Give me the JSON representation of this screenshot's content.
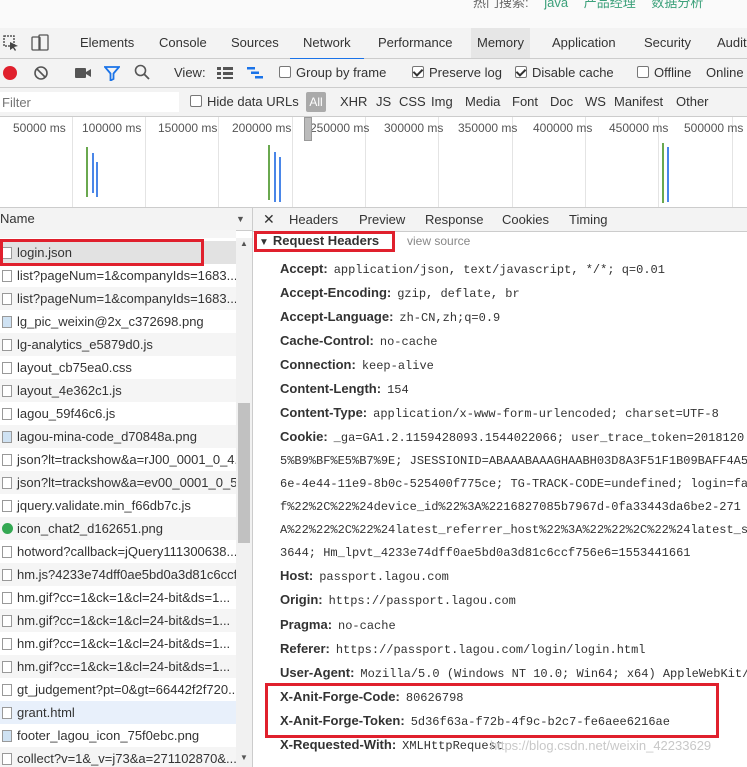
{
  "top": {
    "hot_label": "热门搜索:",
    "keywords": [
      "java",
      "产品经理",
      "数据分析"
    ]
  },
  "devtools_tabs": [
    "Elements",
    "Console",
    "Sources",
    "Network",
    "Performance",
    "Memory",
    "Application",
    "Security",
    "Audit"
  ],
  "active_tab": "Network",
  "toolbar": {
    "view_label": "View:",
    "group_by_frame": "Group by frame",
    "preserve_log": "Preserve log",
    "disable_cache": "Disable cache",
    "offline": "Offline",
    "online": "Online"
  },
  "filterbar": {
    "placeholder": "Filter",
    "hide_data_urls": "Hide data URLs",
    "all": "All",
    "types": [
      "XHR",
      "JS",
      "CSS",
      "Img",
      "Media",
      "Font",
      "Doc",
      "WS",
      "Manifest",
      "Other"
    ]
  },
  "timeline": [
    "50000 ms",
    "100000 ms",
    "150000 ms",
    "200000 ms",
    "250000 ms",
    "300000 ms",
    "350000 ms",
    "400000 ms",
    "450000 ms",
    "500000 ms"
  ],
  "requests": {
    "column_header": "Name",
    "items": [
      "login.json",
      "list?pageNum=1&companyIds=1683...",
      "list?pageNum=1&companyIds=1683...",
      "lg_pic_weixin@2x_c372698.png",
      "lg-analytics_e5879d0.js",
      "layout_cb75ea0.css",
      "layout_4e362c1.js",
      "lagou_59f46c6.js",
      "lagou-mina-code_d70848a.png",
      "json?lt=trackshow&a=rJ00_0001_0_4...",
      "json?lt=trackshow&a=ev00_0001_0_5...",
      "jquery.validate.min_f66db7c.js",
      "icon_chat2_d162651.png",
      "hotword?callback=jQuery111300638...",
      "hm.js?4233e74dff0ae5bd0a3d81c6ccf...",
      "hm.gif?cc=1&ck=1&cl=24-bit&ds=1...",
      "hm.gif?cc=1&ck=1&cl=24-bit&ds=1...",
      "hm.gif?cc=1&ck=1&cl=24-bit&ds=1...",
      "hm.gif?cc=1&ck=1&cl=24-bit&ds=1...",
      "gt_judgement?pt=0&gt=66442f2f720...",
      "grant.html",
      "footer_lagou_icon_75f0ebc.png",
      "collect?v=1&_v=j73&a=271102870&..."
    ]
  },
  "detail_tabs": [
    "Headers",
    "Preview",
    "Response",
    "Cookies",
    "Timing"
  ],
  "request_headers": {
    "title": "Request Headers",
    "view_source": "view source",
    "items": [
      {
        "k": "Accept:",
        "v": "application/json, text/javascript, */*; q=0.01"
      },
      {
        "k": "Accept-Encoding:",
        "v": "gzip, deflate, br"
      },
      {
        "k": "Accept-Language:",
        "v": "zh-CN,zh;q=0.9"
      },
      {
        "k": "Cache-Control:",
        "v": "no-cache"
      },
      {
        "k": "Connection:",
        "v": "keep-alive"
      },
      {
        "k": "Content-Length:",
        "v": "154"
      },
      {
        "k": "Content-Type:",
        "v": "application/x-www-form-urlencoded; charset=UTF-8"
      },
      {
        "k": "Cookie:",
        "v": "_ga=GA1.2.1159428093.1544022066; user_trace_token=2018120"
      }
    ],
    "cookie_cont": [
      "5%B9%BF%E5%B7%9E; JSESSIONID=ABAAABAAAGHAABH03D8A3F51F1B09BAFF4A5",
      "6e-4e44-11e9-8b0c-525400f775ce; TG-TRACK-CODE=undefined; login=fa",
      "f%22%2C%22%24device_id%22%3A%2216827085b7967d-0fa33443da6be2-271",
      "A%22%22%2C%22%24latest_referrer_host%22%3A%22%22%2C%22%24latest_s",
      "3644; Hm_lpvt_4233e74dff0ae5bd0a3d81c6ccf756e6=1553441661"
    ],
    "items2": [
      {
        "k": "Host:",
        "v": "passport.lagou.com"
      },
      {
        "k": "Origin:",
        "v": "https://passport.lagou.com"
      },
      {
        "k": "Pragma:",
        "v": "no-cache"
      },
      {
        "k": "Referer:",
        "v": "https://passport.lagou.com/login/login.html"
      },
      {
        "k": "User-Agent:",
        "v": "Mozilla/5.0 (Windows NT 10.0; Win64; x64) AppleWebKit/"
      },
      {
        "k": "X-Anit-Forge-Code:",
        "v": "80626798"
      },
      {
        "k": "X-Anit-Forge-Token:",
        "v": "5d36f63a-f72b-4f9c-b2c7-fe6aee6216ae"
      },
      {
        "k": "X-Requested-With:",
        "v": "XMLHttpRequest"
      }
    ]
  },
  "watermark": "https://blog.csdn.net/weixin_42233629"
}
